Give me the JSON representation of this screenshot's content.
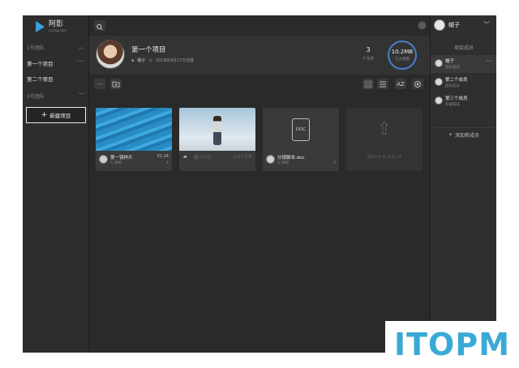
{
  "app": {
    "logo_name": "阿影",
    "logo_sub": "yiying.com"
  },
  "sidebar": {
    "team1_label": "1号团队",
    "team2_label": "2号团队",
    "items": [
      {
        "label": "第一个项目"
      },
      {
        "label": "第二个项目"
      }
    ],
    "more_glyph": "···",
    "new_project_label": "新建项目"
  },
  "project": {
    "title": "第一个项目",
    "owner": "帽子",
    "created": "2018年9月17日创建",
    "file_count": "3",
    "file_count_label": "个文件",
    "storage_value": "10.2MB",
    "storage_label": "已占储量"
  },
  "toolbar": {
    "more": "···",
    "sort_label": "AZ"
  },
  "files": [
    {
      "name": "第一镜样片",
      "size": "5.3MB",
      "duration": "01:24",
      "count": "4"
    },
    {
      "name": "第二个片",
      "size": "",
      "duration": "2.6个文件",
      "count": ""
    },
    {
      "name": "分镜脚本.doc",
      "size": "5.3MB",
      "duration": "",
      "count": "5"
    }
  ],
  "doc_badge": "DOC",
  "upload_text": "选择文件 或 拖拽上传",
  "members": {
    "current_user": "帽子",
    "title": "项目成员",
    "list": [
      {
        "name": "帽子",
        "role": "团队成员"
      },
      {
        "name": "第二个成员",
        "role": "团队成员"
      },
      {
        "name": "第三个成员",
        "role": "外部成员"
      }
    ],
    "add_label": "添加新成员"
  },
  "watermark": "ITOPM",
  "colors": {
    "accent": "#4a7fd0",
    "logo": "#3aa0e0",
    "watermark": "#3aa9d6"
  }
}
